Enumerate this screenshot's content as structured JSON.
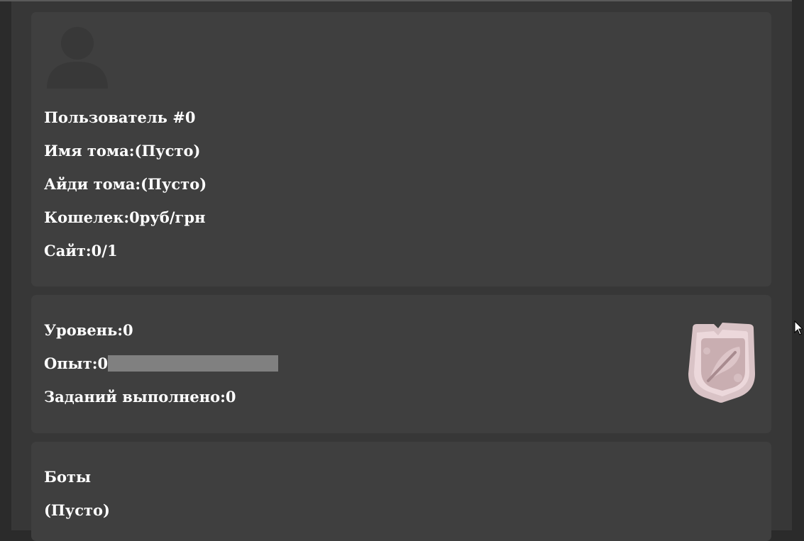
{
  "profile": {
    "user_label": "Пользователь #0",
    "tome_name": "Имя тома:(Пусто)",
    "tome_id": "Айди тома:(Пусто)",
    "wallet": "Кошелек:0руб/грн",
    "site": "Сайт:0/1",
    "avatar_icon": "user-silhouette-icon"
  },
  "progress": {
    "level": "Уровень:0",
    "xp_label": "Опыт:0",
    "xp_fraction": 0,
    "tasks_done": "Заданий выполнено:0",
    "badge_icon": "feather-shield-badge-icon"
  },
  "bots": {
    "title": "Боты",
    "empty": "(Пусто)"
  },
  "colors": {
    "background": "#2b2b2b",
    "column": "#373737",
    "card": "#3f3f3f",
    "text": "#ffffff",
    "xp_track": "#808080",
    "badge": "#e8d3d6"
  }
}
